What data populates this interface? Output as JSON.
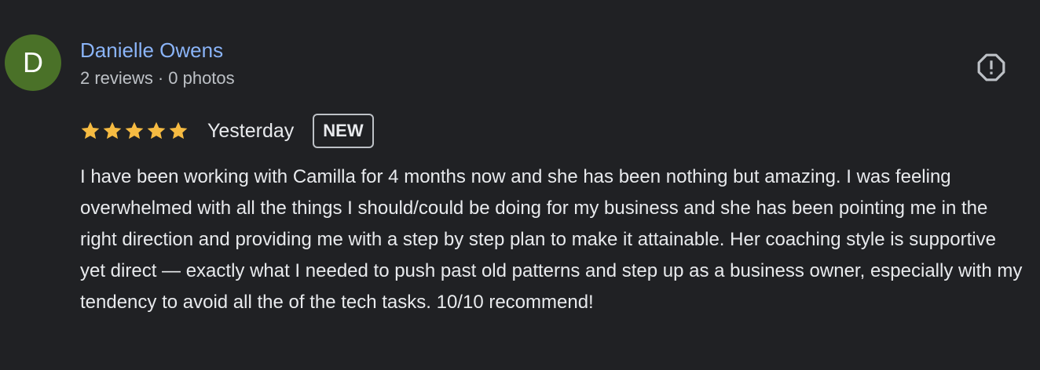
{
  "author": {
    "initial": "D",
    "avatar_color": "#4a7128",
    "name": "Danielle Owens",
    "reviews_count": "2 reviews",
    "separator": "·",
    "photos_count": "0 photos"
  },
  "report": {
    "icon": "report-flag-icon"
  },
  "review": {
    "rating": 5,
    "rating_max": 5,
    "star_color": "#f6bb42",
    "date": "Yesterday",
    "badge": "NEW",
    "text": "I have been working with Camilla for 4 months now and she has been nothing but amazing. I was feeling overwhelmed with all the things I should/could be doing for my business and she has been pointing me in the right direction and providing me with a step by step plan to make it attainable. Her coaching style is supportive yet direct — exactly what I needed to push past old patterns and step up as a business owner, especially with my tendency to avoid all the of the tech tasks. 10/10 recommend!"
  },
  "colors": {
    "background": "#202124",
    "link": "#8ab4f8",
    "text": "#e8eaed",
    "secondary_text": "#bdc1c6"
  }
}
